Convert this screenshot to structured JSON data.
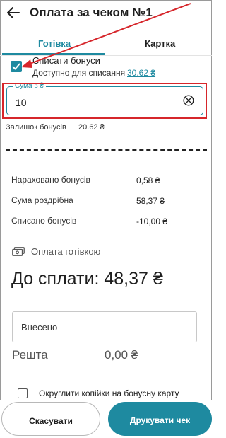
{
  "header": {
    "title": "Оплата за чеком №1",
    "back_icon": "arrow-left-icon"
  },
  "tabs": [
    {
      "label": "Готівка",
      "active": true
    },
    {
      "label": "Картка",
      "active": false
    }
  ],
  "bonus": {
    "write_off_label": "Списати бонуси",
    "write_off_checked": true,
    "available_label": "Доступно для списання",
    "available_value": "30.62 ₴",
    "sum_field_label": "Сума в ₴",
    "sum_field_value": "10",
    "balance_label": "Залишок бонусів",
    "balance_value": "20.62 ₴"
  },
  "summary": [
    {
      "label": "Нараховано бонусів",
      "value": "0,58 ₴"
    },
    {
      "label": "Сума роздрібна",
      "value": "58,37 ₴"
    },
    {
      "label": "Списано бонусів",
      "value": "-10,00 ₴"
    }
  ],
  "payment": {
    "method_label": "Оплата готівкою",
    "method_icon": "cash-icon",
    "to_pay_text": "До сплати: 48,37 ₴",
    "paid_placeholder": "Внесено",
    "change_label": "Решта",
    "change_value": "0,00 ₴"
  },
  "round_option": {
    "label": "Округлити копійки на бонусну карту",
    "checked": false
  },
  "actions": {
    "cancel_label": "Скасувати",
    "print_label": "Друкувати чек"
  },
  "colors": {
    "accent": "#1e8aa0",
    "highlight": "#d6262b"
  }
}
